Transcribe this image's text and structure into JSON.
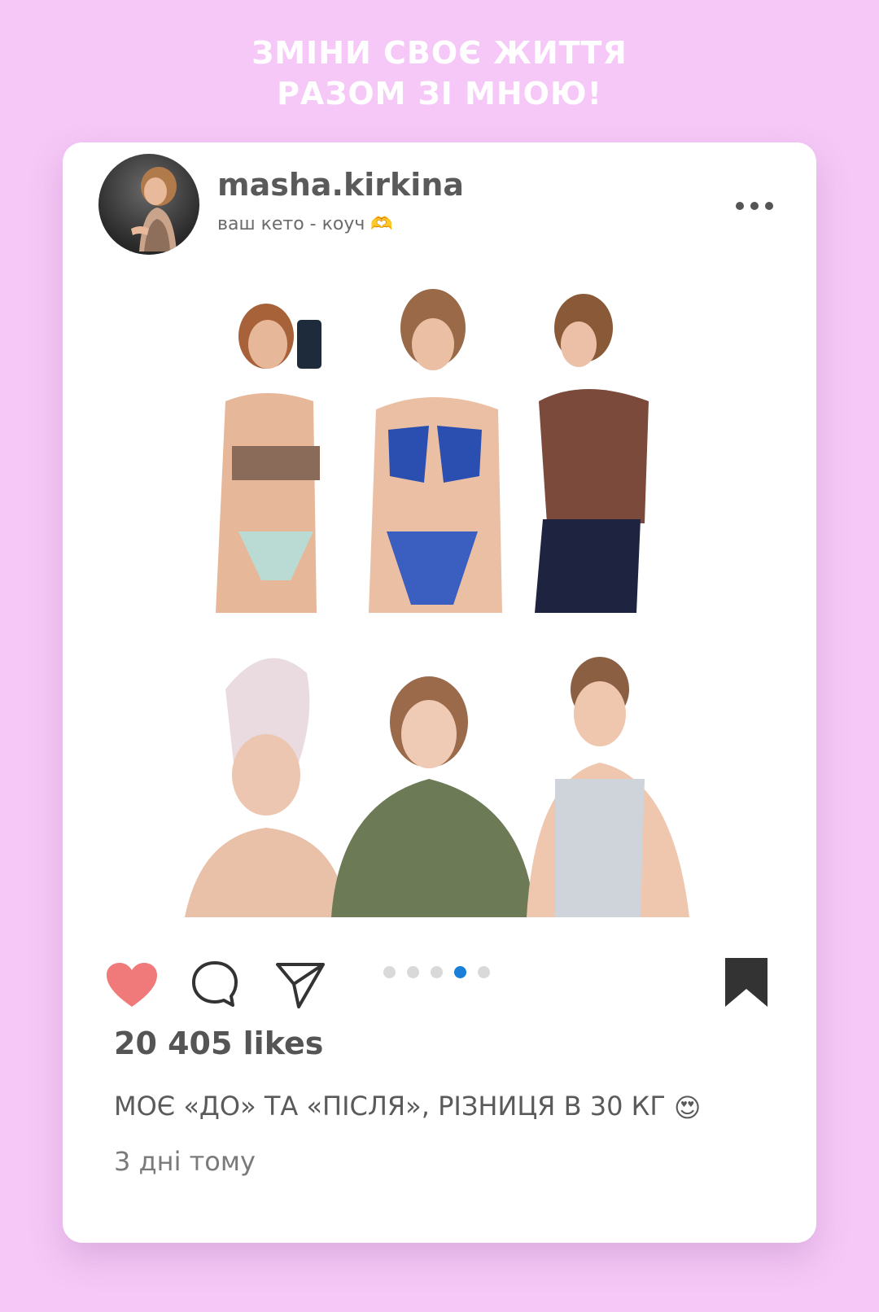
{
  "headline": {
    "line1": "ЗМІНИ СВОЄ ЖИТТЯ",
    "line2": "РАЗОМ ЗІ МНОЮ!"
  },
  "post": {
    "username": "masha.kirkina",
    "subtitle": "ваш кето - коуч 🫶",
    "likes": "20 405 likes",
    "caption": "МОЄ «ДО» ТА «ПІСЛЯ», РІЗНИЦЯ В 30 КГ",
    "caption_emoji": "😍",
    "time": "3 дні тому",
    "carousel": {
      "total": 5,
      "active_index": 3
    }
  },
  "icons": {
    "like": "heart-icon",
    "comment": "comment-icon",
    "share": "send-icon",
    "save": "bookmark-icon",
    "more": "more-icon"
  },
  "colors": {
    "background": "#f5c8f7",
    "card": "#ffffff",
    "heart": "#f07a7a",
    "active_dot": "#1a7fd8"
  }
}
